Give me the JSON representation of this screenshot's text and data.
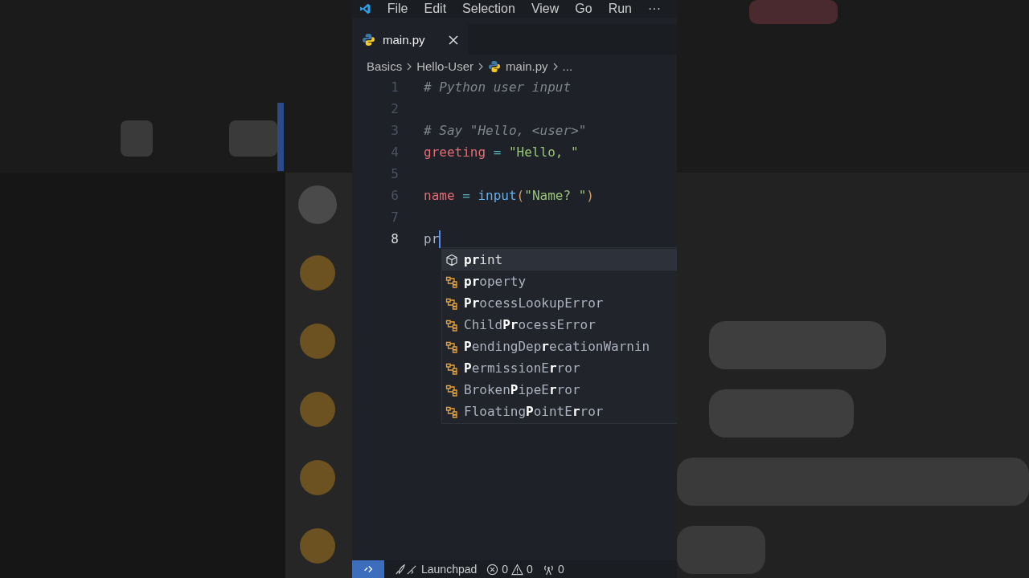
{
  "menu": [
    "File",
    "Edit",
    "Selection",
    "View",
    "Go",
    "Run",
    "···"
  ],
  "tabs": [
    {
      "label": "main.py",
      "selected": true
    }
  ],
  "breadcrumbs": [
    {
      "label": "Basics",
      "kind": "folder"
    },
    {
      "label": "Hello-User",
      "kind": "folder"
    },
    {
      "label": "main.py",
      "kind": "file"
    },
    {
      "label": "...",
      "kind": "more"
    }
  ],
  "lines": [
    {
      "number": "1",
      "current": false,
      "tokens": [
        {
          "kind": "comment",
          "text": "# Python user input"
        }
      ]
    },
    {
      "number": "2",
      "current": false
    },
    {
      "number": "3",
      "current": false,
      "tokens": [
        {
          "kind": "comment",
          "text": "# Say \"Hello, <user>\""
        }
      ]
    },
    {
      "number": "4",
      "current": false,
      "tokens": [
        {
          "kind": "variable",
          "text": "greeting"
        },
        {
          "kind": "operator",
          "text": " = "
        },
        {
          "kind": "string",
          "text": "\"Hello, \""
        }
      ]
    },
    {
      "number": "5",
      "current": false
    },
    {
      "number": "6",
      "current": false,
      "tokens": [
        {
          "kind": "variable",
          "text": "name"
        },
        {
          "kind": "operator",
          "text": " = "
        },
        {
          "kind": "function",
          "text": "input"
        },
        {
          "kind": "paren",
          "text": "("
        },
        {
          "kind": "string",
          "text": "\"Name? \""
        },
        {
          "kind": "paren",
          "text": ")"
        }
      ]
    },
    {
      "number": "7",
      "current": false
    },
    {
      "number": "8",
      "current": true,
      "tokens": [
        {
          "kind": "plain",
          "text": "pr"
        }
      ]
    }
  ],
  "suggestions": [
    {
      "kind": "function",
      "label": "**pr**int",
      "selected": true
    },
    {
      "kind": "class",
      "label": "**pr**operty",
      "selected": false
    },
    {
      "kind": "class",
      "label": "**Pr**ocessLookupError",
      "selected": false
    },
    {
      "kind": "class",
      "label": "Child**Pr**ocessError",
      "selected": false
    },
    {
      "kind": "class",
      "label": "**P**endingDep**r**ecationWarnin",
      "selected": false
    },
    {
      "kind": "class",
      "label": "**P**ermissionE**r**ror",
      "selected": false
    },
    {
      "kind": "class",
      "label": "Broken**P**ipeE**r**ror",
      "selected": false
    },
    {
      "kind": "class",
      "label": "Floating**P**ointE**r**ror",
      "selected": false
    }
  ],
  "status_bar": {
    "launchpad": "Launchpad",
    "errors": "0",
    "warnings": "0",
    "ports": "0"
  }
}
